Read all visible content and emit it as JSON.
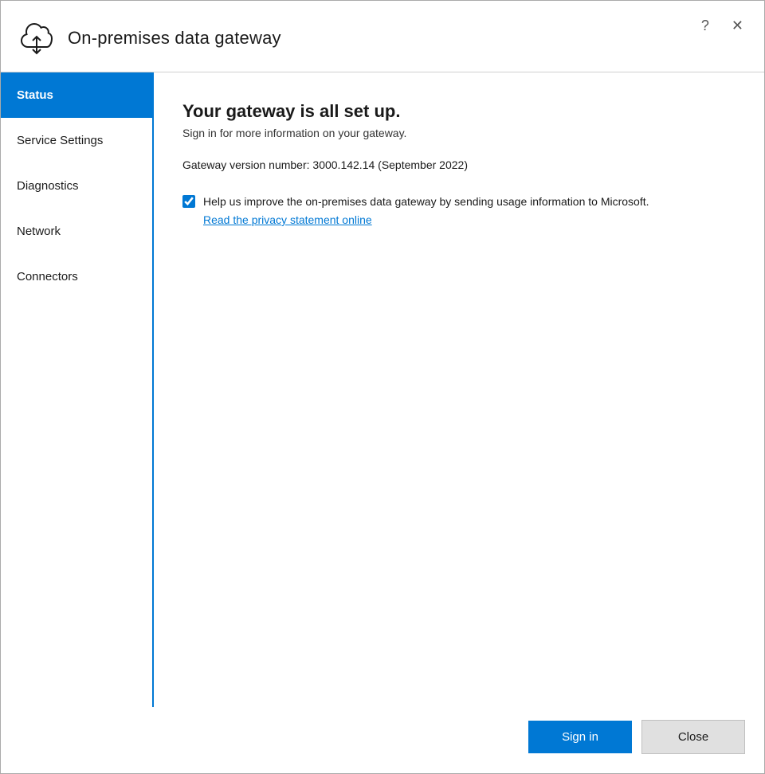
{
  "window": {
    "title": "On-premises data gateway"
  },
  "titlebar": {
    "help_label": "?",
    "close_label": "✕"
  },
  "sidebar": {
    "items": [
      {
        "id": "status",
        "label": "Status",
        "active": true
      },
      {
        "id": "service-settings",
        "label": "Service Settings",
        "active": false
      },
      {
        "id": "diagnostics",
        "label": "Diagnostics",
        "active": false
      },
      {
        "id": "network",
        "label": "Network",
        "active": false
      },
      {
        "id": "connectors",
        "label": "Connectors",
        "active": false
      }
    ]
  },
  "main": {
    "heading": "Your gateway is all set up.",
    "subheading": "Sign in for more information on your gateway.",
    "version_label": "Gateway version number: 3000.142.14 (September 2022)",
    "checkbox_label": "Help us improve the on-premises data gateway by sending usage information to Microsoft.",
    "privacy_link": "Read the privacy statement online",
    "checkbox_checked": true
  },
  "footer": {
    "signin_label": "Sign in",
    "close_label": "Close"
  },
  "colors": {
    "accent": "#0078d4",
    "active_nav_bg": "#0078d4",
    "active_nav_text": "#ffffff"
  }
}
